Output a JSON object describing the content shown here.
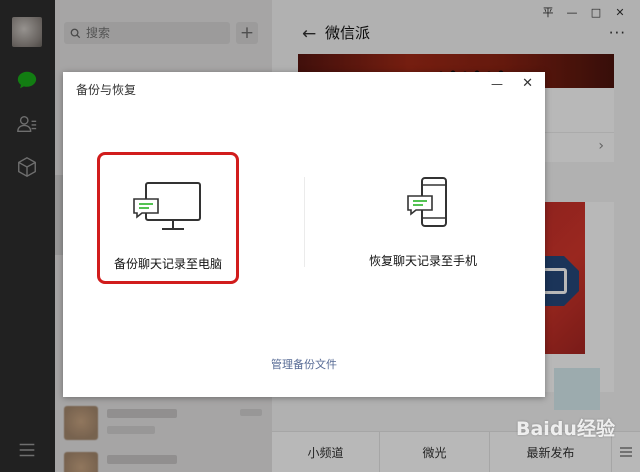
{
  "sidebar": {
    "icons": [
      "avatar",
      "chat-icon",
      "contacts-icon",
      "favorites-icon",
      "menu-icon"
    ],
    "accent_color": "#1aad19"
  },
  "chatlist": {
    "search_placeholder": "搜索",
    "add_label": "+"
  },
  "window": {
    "pin": "平",
    "minimize": "—",
    "maximize": "□",
    "close": "✕"
  },
  "right": {
    "back": "←",
    "title": "微信派",
    "more": "···"
  },
  "bottom_tabs": [
    "小频道",
    "微光",
    "最新发布"
  ],
  "dialog": {
    "title": "备份与恢复",
    "min": "—",
    "close": "✕",
    "option_backup": "备份聊天记录至电脑",
    "option_restore": "恢复聊天记录至手机",
    "manage_link": "管理备份文件",
    "highlight_color": "#d11c1c",
    "link_color": "#576b95"
  },
  "watermark": {
    "text": "Baidu经验"
  }
}
